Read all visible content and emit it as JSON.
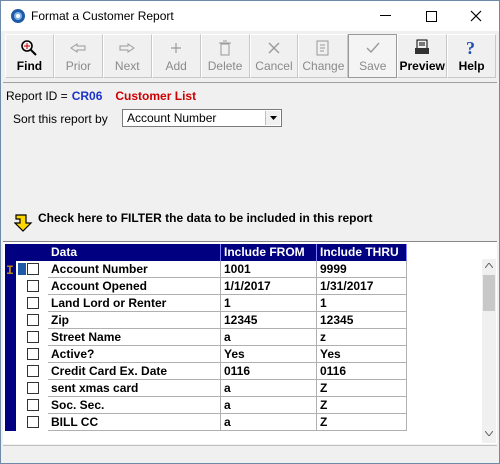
{
  "window": {
    "title": "Format a Customer Report"
  },
  "toolbar": {
    "find": "Find",
    "prior": "Prior",
    "next": "Next",
    "add": "Add",
    "delete": "Delete",
    "cancel": "Cancel",
    "change": "Change",
    "save": "Save",
    "preview": "Preview",
    "help": "Help"
  },
  "report": {
    "id_label": "Report ID =",
    "id_code": "CR06",
    "id_name": "Customer List",
    "sort_label": "Sort this report by",
    "sort_value": "Account Number"
  },
  "filter": {
    "instruction": "Check here to FILTER the data to be included in this report"
  },
  "grid": {
    "headers": {
      "data": "Data",
      "from": "Include FROM",
      "thru": "Include THRU"
    },
    "rows": [
      {
        "data": "Account Number",
        "from": "1001",
        "thru": "9999"
      },
      {
        "data": "Account Opened",
        "from": "1/1/2017",
        "thru": "1/31/2017"
      },
      {
        "data": "Land Lord or Renter",
        "from": "1",
        "thru": "1"
      },
      {
        "data": "Zip",
        "from": "12345",
        "thru": "12345"
      },
      {
        "data": "Street Name",
        "from": "a",
        "thru": "z"
      },
      {
        "data": "Active?",
        "from": "Yes",
        "thru": "Yes"
      },
      {
        "data": "Credit Card Ex. Date",
        "from": "0116",
        "thru": "0116"
      },
      {
        "data": "sent xmas card",
        "from": "a",
        "thru": "Z"
      },
      {
        "data": "Soc. Sec.",
        "from": "a",
        "thru": "Z"
      },
      {
        "data": "BILL CC",
        "from": "a",
        "thru": "Z"
      }
    ]
  },
  "colors": {
    "header_bg": "#000080",
    "report_code": "#1a33c7",
    "report_name": "#cc0000"
  }
}
